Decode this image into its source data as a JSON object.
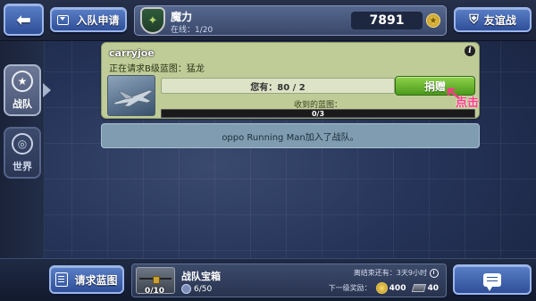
{
  "header": {
    "back_icon": "back-arrow-icon",
    "join_button_label": "入队申请",
    "clan": {
      "name": "魔力",
      "online": "在线：1/20",
      "trophies": "7891",
      "badge_icon": "clan-badge-icon"
    },
    "friend_battle_label": "友谊战"
  },
  "sidebar": {
    "tabs": [
      {
        "label": "战队",
        "icon": "shield-star-icon",
        "active": true
      },
      {
        "label": "世界",
        "icon": "globe-icon",
        "active": false
      }
    ]
  },
  "request_card": {
    "player_name": "carryjoe",
    "request_text": "正在请求B级蓝图：猛龙",
    "have_text": "您有：80 / 2",
    "donate_label": "捐赠",
    "received_label": "收到的蓝图：",
    "progress_text": "0/3",
    "progress_fraction": 0,
    "hint_text": "点击"
  },
  "messages": [
    {
      "text": "oppo Running Man加入了战队。"
    }
  ],
  "footer": {
    "request_blueprint_label": "请求蓝图",
    "chest": {
      "title": "战队宝箱",
      "count": "0/10",
      "members": "6/50",
      "time_left": "离结束还有：3天9小时",
      "next_reward_label": "下一级奖励：",
      "coins": "400",
      "ingots": "40"
    }
  },
  "colors": {
    "card_bg": "#c0cc98",
    "donate_green": "#6cb733",
    "message_bg": "#7f9cb0",
    "hint_pink": "#ff3a8a"
  }
}
